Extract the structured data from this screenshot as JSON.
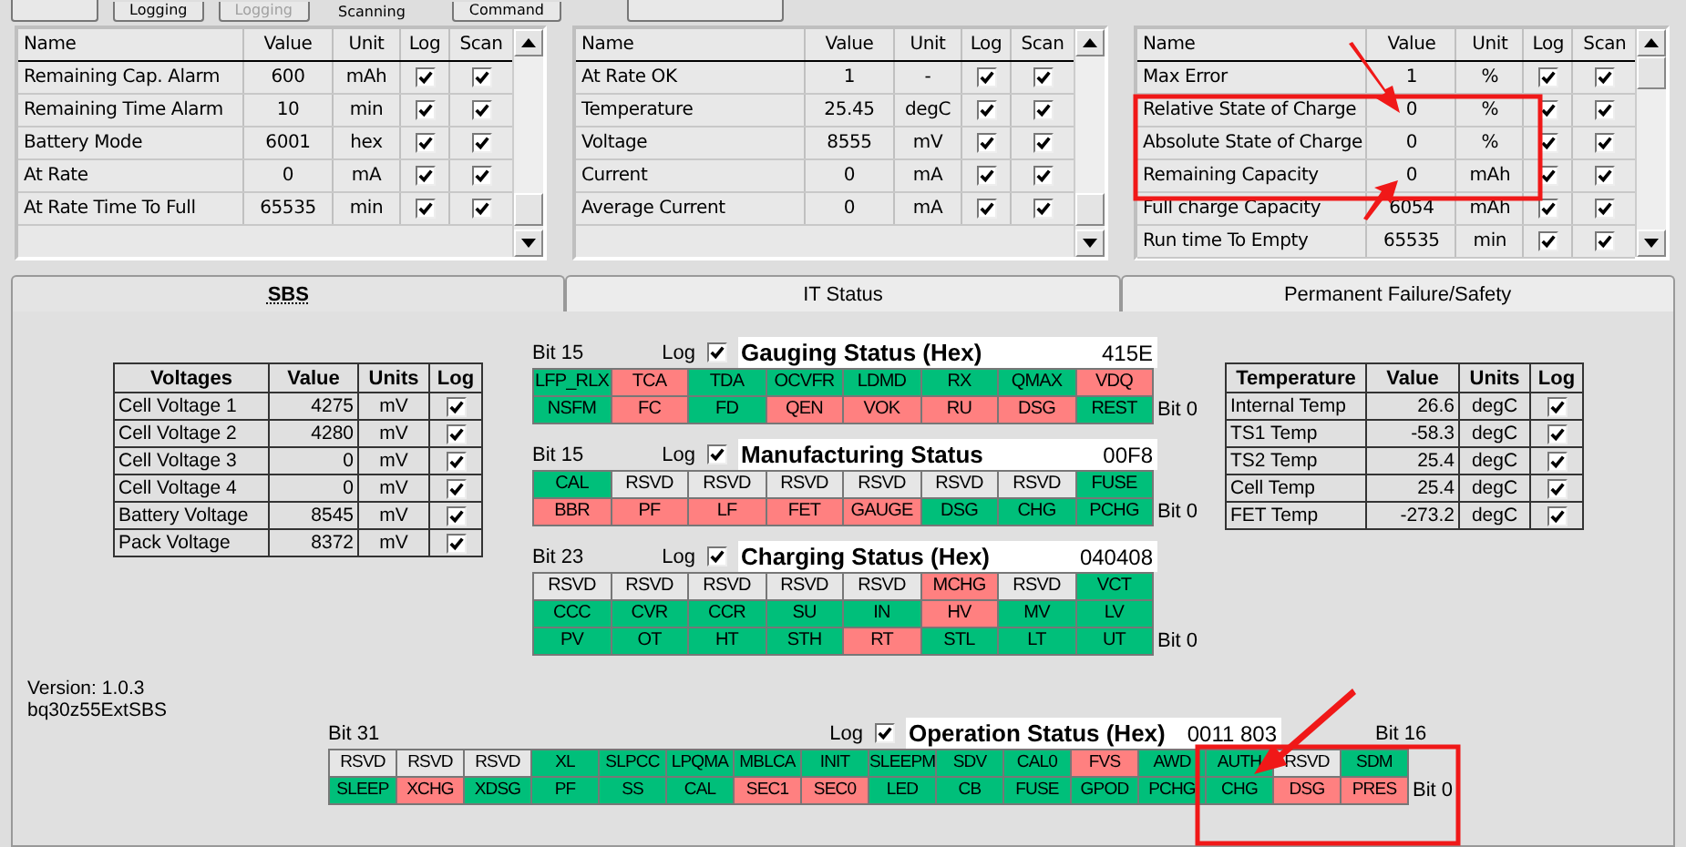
{
  "toolbar": [
    {
      "label": "Logging",
      "disabled": false
    },
    {
      "label": "Logging",
      "disabled": true
    },
    {
      "label": "Scanning",
      "kind": "text"
    },
    {
      "label": "Command",
      "disabled": false
    }
  ],
  "monitor_tables": [
    {
      "columns": [
        "Name",
        "Value",
        "Unit",
        "Log",
        "Scan"
      ],
      "rows": [
        {
          "name": "Remaining Cap. Alarm",
          "value": "600",
          "unit": "mAh",
          "log": true,
          "scan": true
        },
        {
          "name": "Remaining Time Alarm",
          "value": "10",
          "unit": "min",
          "log": true,
          "scan": true
        },
        {
          "name": "Battery Mode",
          "value": "6001",
          "unit": "hex",
          "log": true,
          "scan": true
        },
        {
          "name": "At Rate",
          "value": "0",
          "unit": "mA",
          "log": true,
          "scan": true
        },
        {
          "name": "At Rate Time To Full",
          "value": "65535",
          "unit": "min",
          "log": true,
          "scan": true
        }
      ]
    },
    {
      "columns": [
        "Name",
        "Value",
        "Unit",
        "Log",
        "Scan"
      ],
      "rows": [
        {
          "name": "At Rate OK",
          "value": "1",
          "unit": "-",
          "log": true,
          "scan": true
        },
        {
          "name": "Temperature",
          "value": "25.45",
          "unit": "degC",
          "log": true,
          "scan": true
        },
        {
          "name": "Voltage",
          "value": "8555",
          "unit": "mV",
          "log": true,
          "scan": true
        },
        {
          "name": "Current",
          "value": "0",
          "unit": "mA",
          "log": true,
          "scan": true
        },
        {
          "name": "Average Current",
          "value": "0",
          "unit": "mA",
          "log": true,
          "scan": true
        }
      ]
    },
    {
      "columns": [
        "Name",
        "Value",
        "Unit",
        "Log",
        "Scan"
      ],
      "rows": [
        {
          "name": "Max Error",
          "value": "1",
          "unit": "%",
          "log": true,
          "scan": true
        },
        {
          "name": "Relative State of Charge",
          "value": "0",
          "unit": "%",
          "log": true,
          "scan": true
        },
        {
          "name": "Absolute State of Charge",
          "value": "0",
          "unit": "%",
          "log": true,
          "scan": true
        },
        {
          "name": "Remaining Capacity",
          "value": "0",
          "unit": "mAh",
          "log": true,
          "scan": true
        },
        {
          "name": "Full charge Capacity",
          "value": "6054",
          "unit": "mAh",
          "log": true,
          "scan": true
        },
        {
          "name": "Run time To Empty",
          "value": "65535",
          "unit": "min",
          "log": true,
          "scan": true
        }
      ]
    }
  ],
  "tabs": [
    {
      "label": "SBS",
      "selected": true
    },
    {
      "label": "IT Status",
      "selected": false
    },
    {
      "label": "Permanent Failure/Safety",
      "selected": false
    }
  ],
  "voltages": {
    "columns": [
      "Voltages",
      "Value",
      "Units",
      "Log"
    ],
    "rows": [
      {
        "name": "Cell Voltage 1",
        "value": "4275",
        "unit": "mV",
        "log": true
      },
      {
        "name": "Cell Voltage 2",
        "value": "4280",
        "unit": "mV",
        "log": true
      },
      {
        "name": "Cell Voltage 3",
        "value": "0",
        "unit": "mV",
        "log": true
      },
      {
        "name": "Cell Voltage 4",
        "value": "0",
        "unit": "mV",
        "log": true
      },
      {
        "name": "Battery Voltage",
        "value": "8545",
        "unit": "mV",
        "log": true
      },
      {
        "name": "Pack Voltage",
        "value": "8372",
        "unit": "mV",
        "log": true
      }
    ]
  },
  "status_blocks": [
    {
      "bit_high": "Bit 15",
      "log_label": "Log",
      "log_checked": true,
      "title": "Gauging Status (Hex)",
      "value": "415E",
      "bit_low": "Bit 0",
      "rows": [
        [
          {
            "label": "LFP_RLX",
            "color": "#00bf7a"
          },
          {
            "label": "TCA",
            "color": "#ff8080"
          },
          {
            "label": "TDA",
            "color": "#00bf7a"
          },
          {
            "label": "OCVFR",
            "color": "#00bf7a"
          },
          {
            "label": "LDMD",
            "color": "#00bf7a"
          },
          {
            "label": "RX",
            "color": "#00bf7a"
          },
          {
            "label": "QMAX",
            "color": "#00bf7a"
          },
          {
            "label": "VDQ",
            "color": "#ff8080"
          }
        ],
        [
          {
            "label": "NSFM",
            "color": "#00bf7a"
          },
          {
            "label": "FC",
            "color": "#ff8080"
          },
          {
            "label": "FD",
            "color": "#00bf7a"
          },
          {
            "label": "QEN",
            "color": "#ff8080"
          },
          {
            "label": "VOK",
            "color": "#ff8080"
          },
          {
            "label": "RU",
            "color": "#ff8080"
          },
          {
            "label": "DSG",
            "color": "#ff8080"
          },
          {
            "label": "REST",
            "color": "#00bf7a"
          }
        ]
      ]
    },
    {
      "bit_high": "Bit 15",
      "log_label": "Log",
      "log_checked": true,
      "title": "Manufacturing Status",
      "value": "00F8",
      "bit_low": "Bit 0",
      "rows": [
        [
          {
            "label": "CAL",
            "color": "#00bf7a"
          },
          {
            "label": "RSVD",
            "color": "#e6e6e6"
          },
          {
            "label": "RSVD",
            "color": "#e6e6e6"
          },
          {
            "label": "RSVD",
            "color": "#e6e6e6"
          },
          {
            "label": "RSVD",
            "color": "#e6e6e6"
          },
          {
            "label": "RSVD",
            "color": "#e6e6e6"
          },
          {
            "label": "RSVD",
            "color": "#e6e6e6"
          },
          {
            "label": "FUSE",
            "color": "#00bf7a"
          }
        ],
        [
          {
            "label": "BBR",
            "color": "#ff8080"
          },
          {
            "label": "PF",
            "color": "#ff8080"
          },
          {
            "label": "LF",
            "color": "#ff8080"
          },
          {
            "label": "FET",
            "color": "#ff8080"
          },
          {
            "label": "GAUGE",
            "color": "#ff8080"
          },
          {
            "label": "DSG",
            "color": "#00bf7a"
          },
          {
            "label": "CHG",
            "color": "#00bf7a"
          },
          {
            "label": "PCHG",
            "color": "#00bf7a"
          }
        ]
      ]
    },
    {
      "bit_high": "Bit 23",
      "log_label": "Log",
      "log_checked": true,
      "title": "Charging Status (Hex)",
      "value": "040408",
      "bit_low": "Bit 0",
      "rows": [
        [
          {
            "label": "RSVD",
            "color": "#e6e6e6"
          },
          {
            "label": "RSVD",
            "color": "#e6e6e6"
          },
          {
            "label": "RSVD",
            "color": "#e6e6e6"
          },
          {
            "label": "RSVD",
            "color": "#e6e6e6"
          },
          {
            "label": "RSVD",
            "color": "#e6e6e6"
          },
          {
            "label": "MCHG",
            "color": "#ff8080"
          },
          {
            "label": "RSVD",
            "color": "#e6e6e6"
          },
          {
            "label": "VCT",
            "color": "#00bf7a"
          }
        ],
        [
          {
            "label": "CCC",
            "color": "#00bf7a"
          },
          {
            "label": "CVR",
            "color": "#00bf7a"
          },
          {
            "label": "CCR",
            "color": "#00bf7a"
          },
          {
            "label": "SU",
            "color": "#00bf7a"
          },
          {
            "label": "IN",
            "color": "#00bf7a"
          },
          {
            "label": "HV",
            "color": "#ff8080"
          },
          {
            "label": "MV",
            "color": "#00bf7a"
          },
          {
            "label": "LV",
            "color": "#00bf7a"
          }
        ],
        [
          {
            "label": "PV",
            "color": "#00bf7a"
          },
          {
            "label": "OT",
            "color": "#00bf7a"
          },
          {
            "label": "HT",
            "color": "#00bf7a"
          },
          {
            "label": "STH",
            "color": "#00bf7a"
          },
          {
            "label": "RT",
            "color": "#ff8080"
          },
          {
            "label": "STL",
            "color": "#00bf7a"
          },
          {
            "label": "LT",
            "color": "#00bf7a"
          },
          {
            "label": "UT",
            "color": "#00bf7a"
          }
        ]
      ]
    }
  ],
  "temperature": {
    "columns": [
      "Temperature",
      "Value",
      "Units",
      "Log"
    ],
    "rows": [
      {
        "name": "Internal Temp",
        "value": "26.6",
        "unit": "degC",
        "log": true
      },
      {
        "name": "TS1 Temp",
        "value": "-58.3",
        "unit": "degC",
        "log": true
      },
      {
        "name": "TS2 Temp",
        "value": "25.4",
        "unit": "degC",
        "log": true
      },
      {
        "name": "Cell Temp",
        "value": "25.4",
        "unit": "degC",
        "log": true
      },
      {
        "name": "FET Temp",
        "value": "-273.2",
        "unit": "degC",
        "log": true
      }
    ]
  },
  "version": {
    "line_1": "Version: 1.0.3",
    "line_2": "bq30z55ExtSBS"
  },
  "operation_status": {
    "bit_high": "Bit 31",
    "log_label": "Log",
    "log_checked": true,
    "title": "Operation Status (Hex)",
    "value": "0011 803",
    "bit_mid": "Bit 16",
    "bit_low": "Bit 0",
    "rows": [
      [
        {
          "label": "RSVD",
          "color": "#e6e6e6"
        },
        {
          "label": "RSVD",
          "color": "#e6e6e6"
        },
        {
          "label": "RSVD",
          "color": "#e6e6e6"
        },
        {
          "label": "XL",
          "color": "#00bf7a"
        },
        {
          "label": "SLPCC",
          "color": "#00bf7a"
        },
        {
          "label": "LPQMA",
          "color": "#00bf7a"
        },
        {
          "label": "MBLCA",
          "color": "#00bf7a"
        },
        {
          "label": "INIT",
          "color": "#00bf7a"
        },
        {
          "label": "SLEEPM",
          "color": "#00bf7a"
        },
        {
          "label": "SDV",
          "color": "#00bf7a"
        },
        {
          "label": "CAL0",
          "color": "#00bf7a"
        },
        {
          "label": "FVS",
          "color": "#ff8080"
        },
        {
          "label": "AWD",
          "color": "#00bf7a"
        },
        {
          "label": "AUTH",
          "color": "#00bf7a"
        },
        {
          "label": "RSVD",
          "color": "#e6e6e6"
        },
        {
          "label": "SDM",
          "color": "#00bf7a"
        }
      ],
      [
        {
          "label": "SLEEP",
          "color": "#00bf7a"
        },
        {
          "label": "XCHG",
          "color": "#ff8080"
        },
        {
          "label": "XDSG",
          "color": "#00bf7a"
        },
        {
          "label": "PF",
          "color": "#00bf7a"
        },
        {
          "label": "SS",
          "color": "#00bf7a"
        },
        {
          "label": "CAL",
          "color": "#00bf7a"
        },
        {
          "label": "SEC1",
          "color": "#ff8080"
        },
        {
          "label": "SEC0",
          "color": "#ff8080"
        },
        {
          "label": "LED",
          "color": "#00bf7a"
        },
        {
          "label": "CB",
          "color": "#00bf7a"
        },
        {
          "label": "FUSE",
          "color": "#00bf7a"
        },
        {
          "label": "GPOD",
          "color": "#00bf7a"
        },
        {
          "label": "PCHG",
          "color": "#00bf7a"
        },
        {
          "label": "CHG",
          "color": "#00bf7a"
        },
        {
          "label": "DSG",
          "color": "#ff8080"
        },
        {
          "label": "PRES",
          "color": "#ff8080"
        }
      ]
    ]
  }
}
